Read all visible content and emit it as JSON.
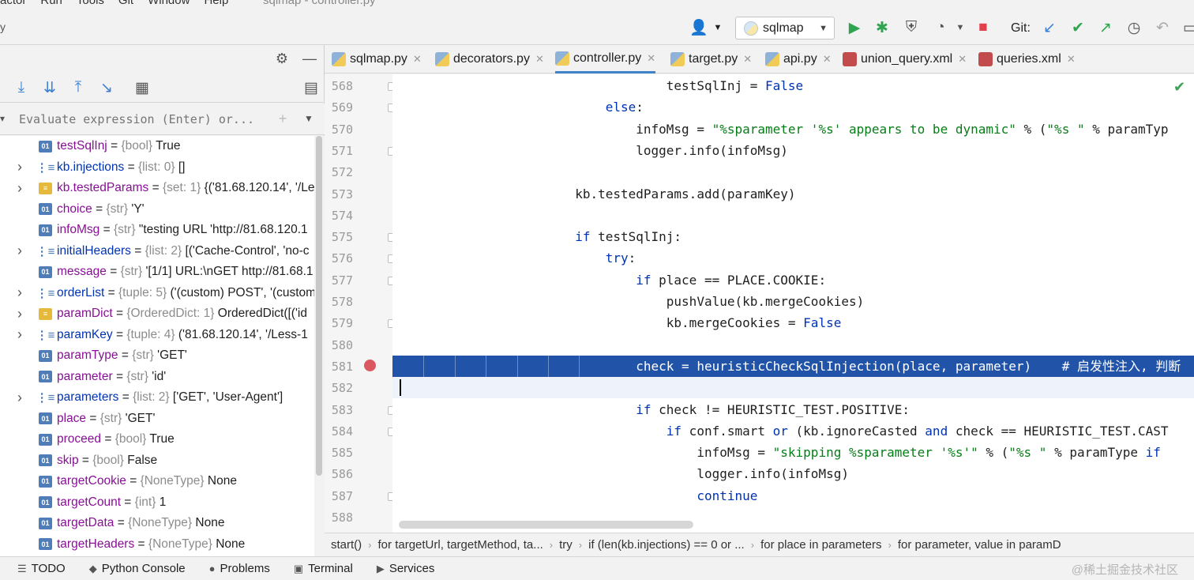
{
  "menubar": {
    "items": [
      "actor",
      "Run",
      "Tools",
      "Git",
      "Window",
      "Help"
    ],
    "window_title": "sqlmap - controller.py"
  },
  "toolbar": {
    "left_mark": "y",
    "run_config": "sqlmap",
    "git_label": "Git:"
  },
  "debug_panel": {
    "eval_placeholder": "Evaluate expression (Enter) or..."
  },
  "variables": [
    {
      "expand": false,
      "icon": "01",
      "name": "testSqlInj",
      "type": "{bool}",
      "value": "True"
    },
    {
      "expand": true,
      "icon": "list",
      "name": "kb.injections",
      "type": "{list: 0}",
      "value": "[]"
    },
    {
      "expand": true,
      "icon": "set",
      "name": "kb.testedParams",
      "type": "{set: 1}",
      "value": "{('81.68.120.14', '/Le"
    },
    {
      "expand": false,
      "icon": "01",
      "name": "choice",
      "type": "{str}",
      "value": "'Y'"
    },
    {
      "expand": false,
      "icon": "01",
      "name": "infoMsg",
      "type": "{str}",
      "value": "\"testing URL 'http://81.68.120.1"
    },
    {
      "expand": true,
      "icon": "list",
      "name": "initialHeaders",
      "type": "{list: 2}",
      "value": "[('Cache-Control', 'no-c"
    },
    {
      "expand": false,
      "icon": "01",
      "name": "message",
      "type": "{str}",
      "value": "'[1/1] URL:\\nGET http://81.68.1"
    },
    {
      "expand": true,
      "icon": "list",
      "name": "orderList",
      "type": "{tuple: 5}",
      "value": "('(custom) POST', '(custom"
    },
    {
      "expand": true,
      "icon": "set",
      "name": "paramDict",
      "type": "{OrderedDict: 1}",
      "value": "OrderedDict([('id"
    },
    {
      "expand": true,
      "icon": "list",
      "name": "paramKey",
      "type": "{tuple: 4}",
      "value": "('81.68.120.14', '/Less-1"
    },
    {
      "expand": false,
      "icon": "01",
      "name": "paramType",
      "type": "{str}",
      "value": "'GET'"
    },
    {
      "expand": false,
      "icon": "01",
      "name": "parameter",
      "type": "{str}",
      "value": "'id'"
    },
    {
      "expand": true,
      "icon": "list",
      "name": "parameters",
      "type": "{list: 2}",
      "value": "['GET', 'User-Agent']"
    },
    {
      "expand": false,
      "icon": "01",
      "name": "place",
      "type": "{str}",
      "value": "'GET'"
    },
    {
      "expand": false,
      "icon": "01",
      "name": "proceed",
      "type": "{bool}",
      "value": "True"
    },
    {
      "expand": false,
      "icon": "01",
      "name": "skip",
      "type": "{bool}",
      "value": "False"
    },
    {
      "expand": false,
      "icon": "01",
      "name": "targetCookie",
      "type": "{NoneType}",
      "value": "None"
    },
    {
      "expand": false,
      "icon": "01",
      "name": "targetCount",
      "type": "{int}",
      "value": "1"
    },
    {
      "expand": false,
      "icon": "01",
      "name": "targetData",
      "type": "{NoneType}",
      "value": "None"
    },
    {
      "expand": false,
      "icon": "01",
      "name": "targetHeaders",
      "type": "{NoneType}",
      "value": "None"
    }
  ],
  "tabs": [
    {
      "label": "sqlmap.py",
      "kind": "py",
      "active": false
    },
    {
      "label": "decorators.py",
      "kind": "py",
      "active": false
    },
    {
      "label": "controller.py",
      "kind": "py",
      "active": true
    },
    {
      "label": "target.py",
      "kind": "py",
      "active": false
    },
    {
      "label": "api.py",
      "kind": "py",
      "active": false
    },
    {
      "label": "union_query.xml",
      "kind": "xml",
      "active": false
    },
    {
      "label": "queries.xml",
      "kind": "xml",
      "active": false
    }
  ],
  "code_lines": [
    {
      "n": "568",
      "fold": true,
      "indent": 9,
      "tokens": [
        [
          "",
          "testSqlInj = "
        ],
        [
          "kw",
          "False"
        ]
      ]
    },
    {
      "n": "569",
      "fold": true,
      "indent": 7,
      "tokens": [
        [
          "kw",
          "else"
        ],
        [
          "",
          ":"
        ]
      ]
    },
    {
      "n": "570",
      "fold": false,
      "indent": 8,
      "tokens": [
        [
          "",
          "infoMsg = "
        ],
        [
          "str",
          "\"%sparameter '%s' appears to be dynamic\""
        ],
        [
          "",
          " % ("
        ],
        [
          "str",
          "\"%s \""
        ],
        [
          "",
          " % paramTyp"
        ]
      ]
    },
    {
      "n": "571",
      "fold": true,
      "indent": 8,
      "tokens": [
        [
          "",
          "logger.info(infoMsg)"
        ]
      ]
    },
    {
      "n": "572",
      "fold": false,
      "indent": 0,
      "tokens": []
    },
    {
      "n": "573",
      "fold": false,
      "indent": 6,
      "tokens": [
        [
          "",
          "kb.testedParams.add(paramKey)"
        ]
      ]
    },
    {
      "n": "574",
      "fold": false,
      "indent": 0,
      "tokens": []
    },
    {
      "n": "575",
      "fold": true,
      "indent": 6,
      "tokens": [
        [
          "kw",
          "if"
        ],
        [
          "",
          " testSqlInj:"
        ]
      ]
    },
    {
      "n": "576",
      "fold": true,
      "indent": 7,
      "tokens": [
        [
          "kw",
          "try"
        ],
        [
          "",
          ":"
        ]
      ]
    },
    {
      "n": "577",
      "fold": true,
      "indent": 8,
      "tokens": [
        [
          "kw",
          "if"
        ],
        [
          "",
          " place == PLACE.COOKIE:"
        ]
      ]
    },
    {
      "n": "578",
      "fold": false,
      "indent": 9,
      "tokens": [
        [
          "",
          "pushValue(kb.mergeCookies)"
        ]
      ]
    },
    {
      "n": "579",
      "fold": true,
      "indent": 9,
      "tokens": [
        [
          "",
          "kb.mergeCookies = "
        ],
        [
          "kw",
          "False"
        ]
      ]
    },
    {
      "n": "580",
      "fold": false,
      "indent": 0,
      "tokens": []
    },
    {
      "n": "581",
      "fold": false,
      "indent": 8,
      "highlight": true,
      "tokens": [
        [
          "",
          "check = heuristicCheckSqlInjection(place, parameter)    "
        ],
        [
          "cmt",
          "# 启发性注入, 判断"
        ]
      ]
    },
    {
      "n": "582",
      "fold": false,
      "indent": 0,
      "current": true,
      "tokens": []
    },
    {
      "n": "583",
      "fold": true,
      "indent": 8,
      "tokens": [
        [
          "kw",
          "if"
        ],
        [
          "",
          " check != HEURISTIC_TEST.POSITIVE:"
        ]
      ]
    },
    {
      "n": "584",
      "fold": true,
      "indent": 9,
      "tokens": [
        [
          "kw",
          "if"
        ],
        [
          "",
          " conf.smart "
        ],
        [
          "kw",
          "or"
        ],
        [
          "",
          " (kb.ignoreCasted "
        ],
        [
          "kw",
          "and"
        ],
        [
          "",
          " check == HEURISTIC_TEST.CAST"
        ]
      ]
    },
    {
      "n": "585",
      "fold": false,
      "indent": 10,
      "tokens": [
        [
          "",
          "infoMsg = "
        ],
        [
          "str",
          "\"skipping %sparameter '%s'\""
        ],
        [
          "",
          " % ("
        ],
        [
          "str",
          "\"%s \""
        ],
        [
          "",
          " % paramType "
        ],
        [
          "kw",
          "if"
        ]
      ]
    },
    {
      "n": "586",
      "fold": false,
      "indent": 10,
      "tokens": [
        [
          "",
          "logger.info(infoMsg)"
        ]
      ]
    },
    {
      "n": "587",
      "fold": true,
      "indent": 10,
      "tokens": [
        [
          "kw",
          "continue"
        ]
      ]
    },
    {
      "n": "588",
      "fold": false,
      "indent": 0,
      "tokens": []
    }
  ],
  "breadcrumbs": [
    "start()",
    "for targetUrl, targetMethod, ta...",
    "try",
    "if (len(kb.injections) == 0 or ...",
    "for place in parameters",
    "for parameter, value in paramD"
  ],
  "statusbar": [
    {
      "icon": "list-icon",
      "glyph": "☰",
      "label": "TODO"
    },
    {
      "icon": "python-icon",
      "glyph": "◆",
      "label": "Python Console"
    },
    {
      "icon": "problems-icon",
      "glyph": "●",
      "label": "Problems"
    },
    {
      "icon": "terminal-icon",
      "glyph": "▣",
      "label": "Terminal"
    },
    {
      "icon": "services-icon",
      "glyph": "▶",
      "label": "Services"
    }
  ],
  "watermark": "@稀土掘金技术社区",
  "colors": {
    "highlight_line": "#2154a8",
    "breakpoint": "#db5860",
    "run": "#2ea44f",
    "stop": "#e0414b"
  }
}
